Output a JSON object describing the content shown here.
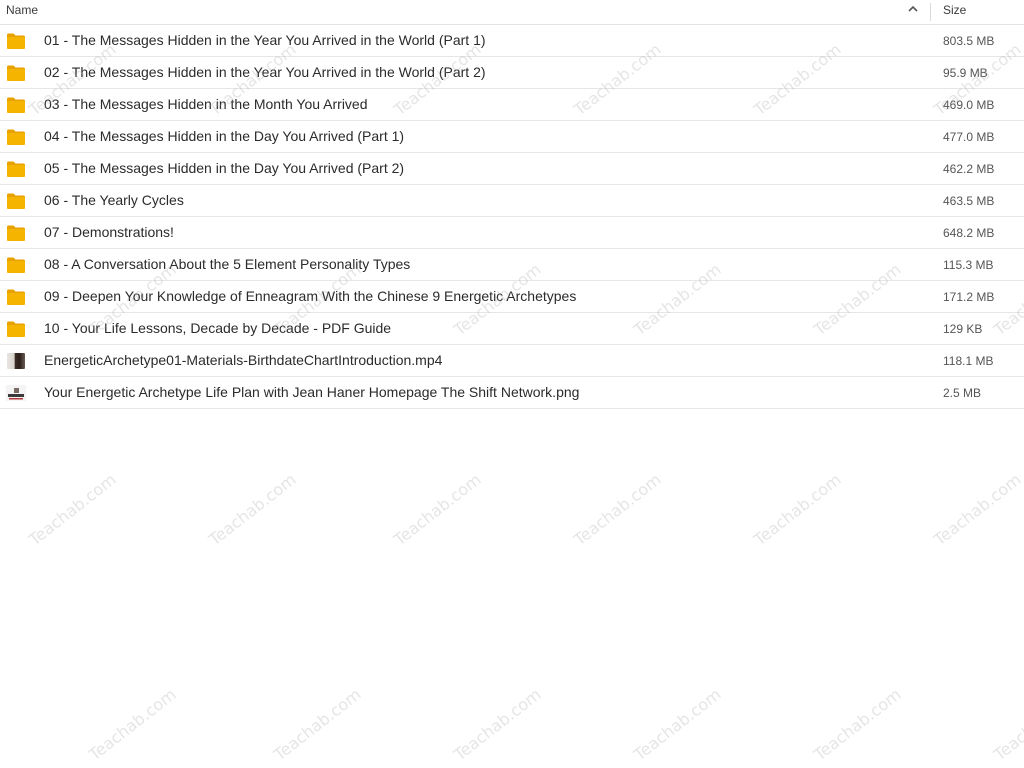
{
  "header": {
    "name_label": "Name",
    "size_label": "Size"
  },
  "files": [
    {
      "type": "folder",
      "icon": "folder-icon",
      "name": "01 - The Messages Hidden in the Year You Arrived in the World (Part 1)",
      "size": "803.5 MB"
    },
    {
      "type": "folder",
      "icon": "folder-icon",
      "name": "02 - The Messages Hidden in the Year You Arrived in the World (Part 2)",
      "size": "95.9 MB"
    },
    {
      "type": "folder",
      "icon": "folder-icon",
      "name": "03 - The Messages Hidden in the Month You Arrived",
      "size": "469.0 MB"
    },
    {
      "type": "folder",
      "icon": "folder-icon",
      "name": "04 - The Messages Hidden in the Day You Arrived (Part 1)",
      "size": "477.0 MB"
    },
    {
      "type": "folder",
      "icon": "folder-icon",
      "name": "05 - The Messages Hidden in the Day You Arrived (Part 2)",
      "size": "462.2 MB"
    },
    {
      "type": "folder",
      "icon": "folder-icon",
      "name": "06 - The Yearly Cycles",
      "size": "463.5 MB"
    },
    {
      "type": "folder",
      "icon": "folder-icon",
      "name": "07 - Demonstrations!",
      "size": "648.2 MB"
    },
    {
      "type": "folder",
      "icon": "folder-icon",
      "name": "08 - A Conversation About the 5 Element Personality Types",
      "size": "115.3 MB"
    },
    {
      "type": "folder",
      "icon": "folder-icon",
      "name": "09 - Deepen Your Knowledge of Enneagram With the Chinese 9 Energetic Archetypes",
      "size": "171.2 MB"
    },
    {
      "type": "folder",
      "icon": "folder-icon",
      "name": "10 - Your Life Lessons, Decade by Decade - PDF Guide",
      "size": "129 KB"
    },
    {
      "type": "video",
      "icon": "video-thumbnail-icon",
      "name": "EnergeticArchetype01-Materials-BirthdateChartIntroduction.mp4",
      "size": "118.1 MB"
    },
    {
      "type": "image",
      "icon": "image-thumbnail-icon",
      "name": "Your Energetic Archetype Life Plan with Jean Haner Homepage The Shift Network.png",
      "size": "2.5 MB"
    }
  ],
  "watermark_text": "Teachab.com",
  "colors": {
    "folder": "#f5b400",
    "folder_tab": "#e8a200",
    "row_border": "#e6e6e6"
  }
}
